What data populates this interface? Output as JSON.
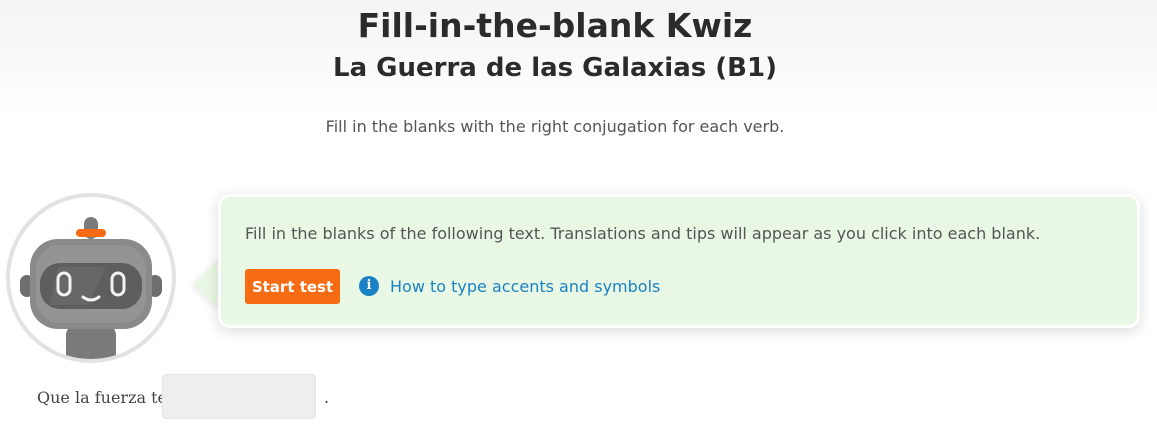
{
  "header": {
    "title": "Fill-in-the-blank Kwiz",
    "subtitle": "La Guerra de las Galaxias (B1)",
    "instructions": "Fill in the blanks with the right conjugation for each verb."
  },
  "tip_bubble": {
    "text": "Fill in the blanks of the following text. Translations and tips will appear as you click into each blank.",
    "start_button_label": "Start test",
    "accents_link_label": "How to type accents and symbols",
    "info_icon_glyph": "i"
  },
  "exercise": {
    "sentence_prefix": "Que la fuerza te",
    "blank_value": "",
    "sentence_suffix": "."
  },
  "colors": {
    "accent_orange": "#f76b12",
    "link_blue": "#1a82c4",
    "bubble_green": "#e9f8e4",
    "robot_gray": "#8a8a8a"
  }
}
